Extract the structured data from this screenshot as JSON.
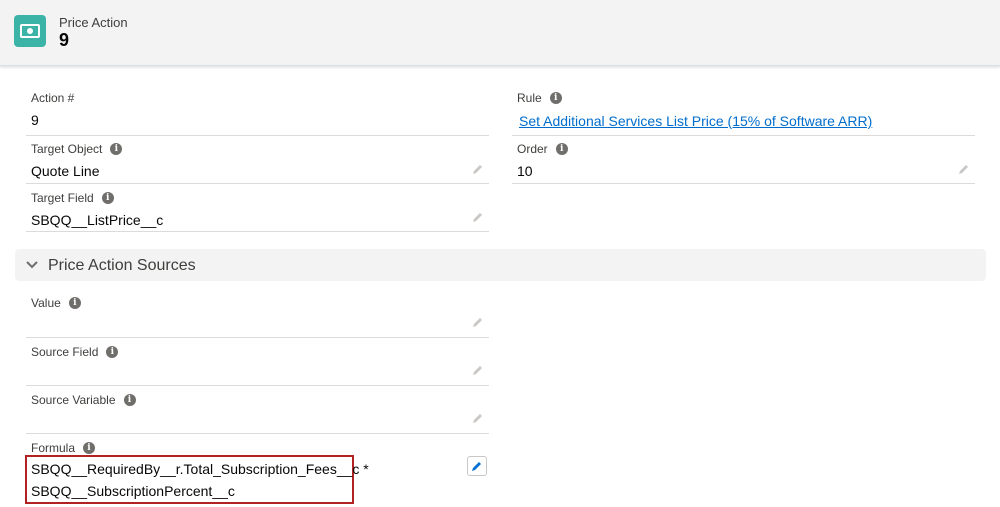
{
  "header": {
    "object_label": "Price Action",
    "record_name": "9",
    "icon": "money-icon"
  },
  "fields": {
    "action_number": {
      "label": "Action #",
      "value": "9"
    },
    "rule": {
      "label": "Rule",
      "value": "Set Additional Services List Price (15% of Software ARR)"
    },
    "target_object": {
      "label": "Target Object",
      "value": "Quote Line"
    },
    "order": {
      "label": "Order",
      "value": "10"
    },
    "target_field": {
      "label": "Target Field",
      "value": "SBQQ__ListPrice__c"
    }
  },
  "section": {
    "title": "Price Action Sources",
    "icon": "chevron-down-icon"
  },
  "sources": {
    "value": {
      "label": "Value",
      "value": ""
    },
    "source_field": {
      "label": "Source Field",
      "value": ""
    },
    "source_variable": {
      "label": "Source Variable",
      "value": ""
    },
    "formula": {
      "label": "Formula",
      "line1": "SBQQ__RequiredBy__r.Total_Subscription_Fees__c *",
      "line2": "SBQQ__SubscriptionPercent__c"
    }
  },
  "colors": {
    "header_icon_bg": "#3bb3a7",
    "link": "#006dcc",
    "highlight_border": "#b22222",
    "edit_icon": "#0070d2"
  }
}
